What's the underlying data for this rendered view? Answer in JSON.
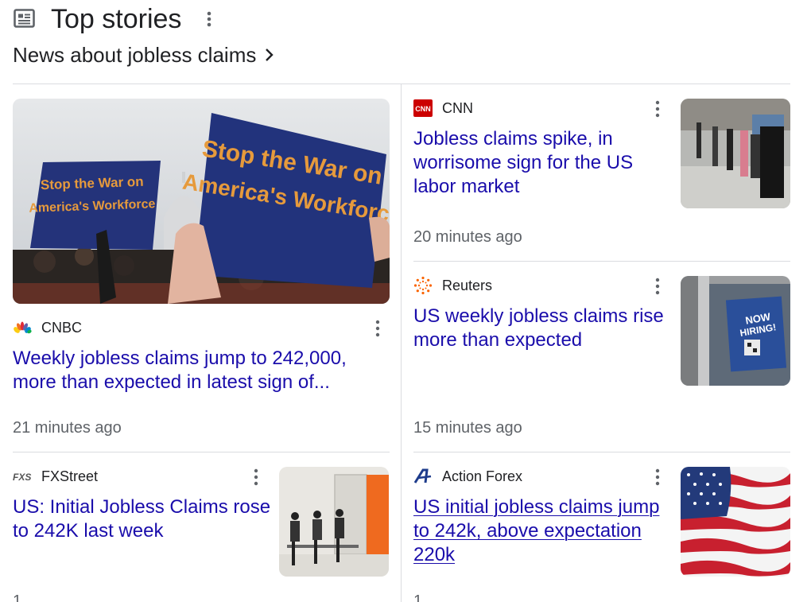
{
  "header": {
    "title": "Top stories",
    "subtitle": "News about jobless claims"
  },
  "stories": [
    {
      "source": "CNBC",
      "headline": "Weekly jobless claims jump to 242,000, more than expected in latest sign of...",
      "time": "21 minutes ago",
      "image_text_1": "Stop the War on",
      "image_text_2": "America's Workforce",
      "image_text_3": "Stop the War on",
      "image_text_4": "America's Workforce"
    },
    {
      "source": "CNN",
      "logo_text": "CNN",
      "headline": "Jobless claims spike, in worrisome sign for the US labor market",
      "time": "20 minutes ago"
    },
    {
      "source": "Reuters",
      "headline": "US weekly jobless claims rise more than expected",
      "time": "15 minutes ago",
      "image_text_1": "NOW",
      "image_text_2": "HIRING!"
    },
    {
      "source": "FXStreet",
      "logo_text": "FXS",
      "headline": "US: Initial Jobless Claims rose to 242K last week",
      "time": "1"
    },
    {
      "source": "Action Forex",
      "headline": "US initial jobless claims jump to 242k, above expectation 220k",
      "time": "1"
    }
  ],
  "colors": {
    "link": "#1a0dab",
    "meta": "#5f6368",
    "divider": "#dadce0",
    "cnn_red": "#cc0000"
  }
}
